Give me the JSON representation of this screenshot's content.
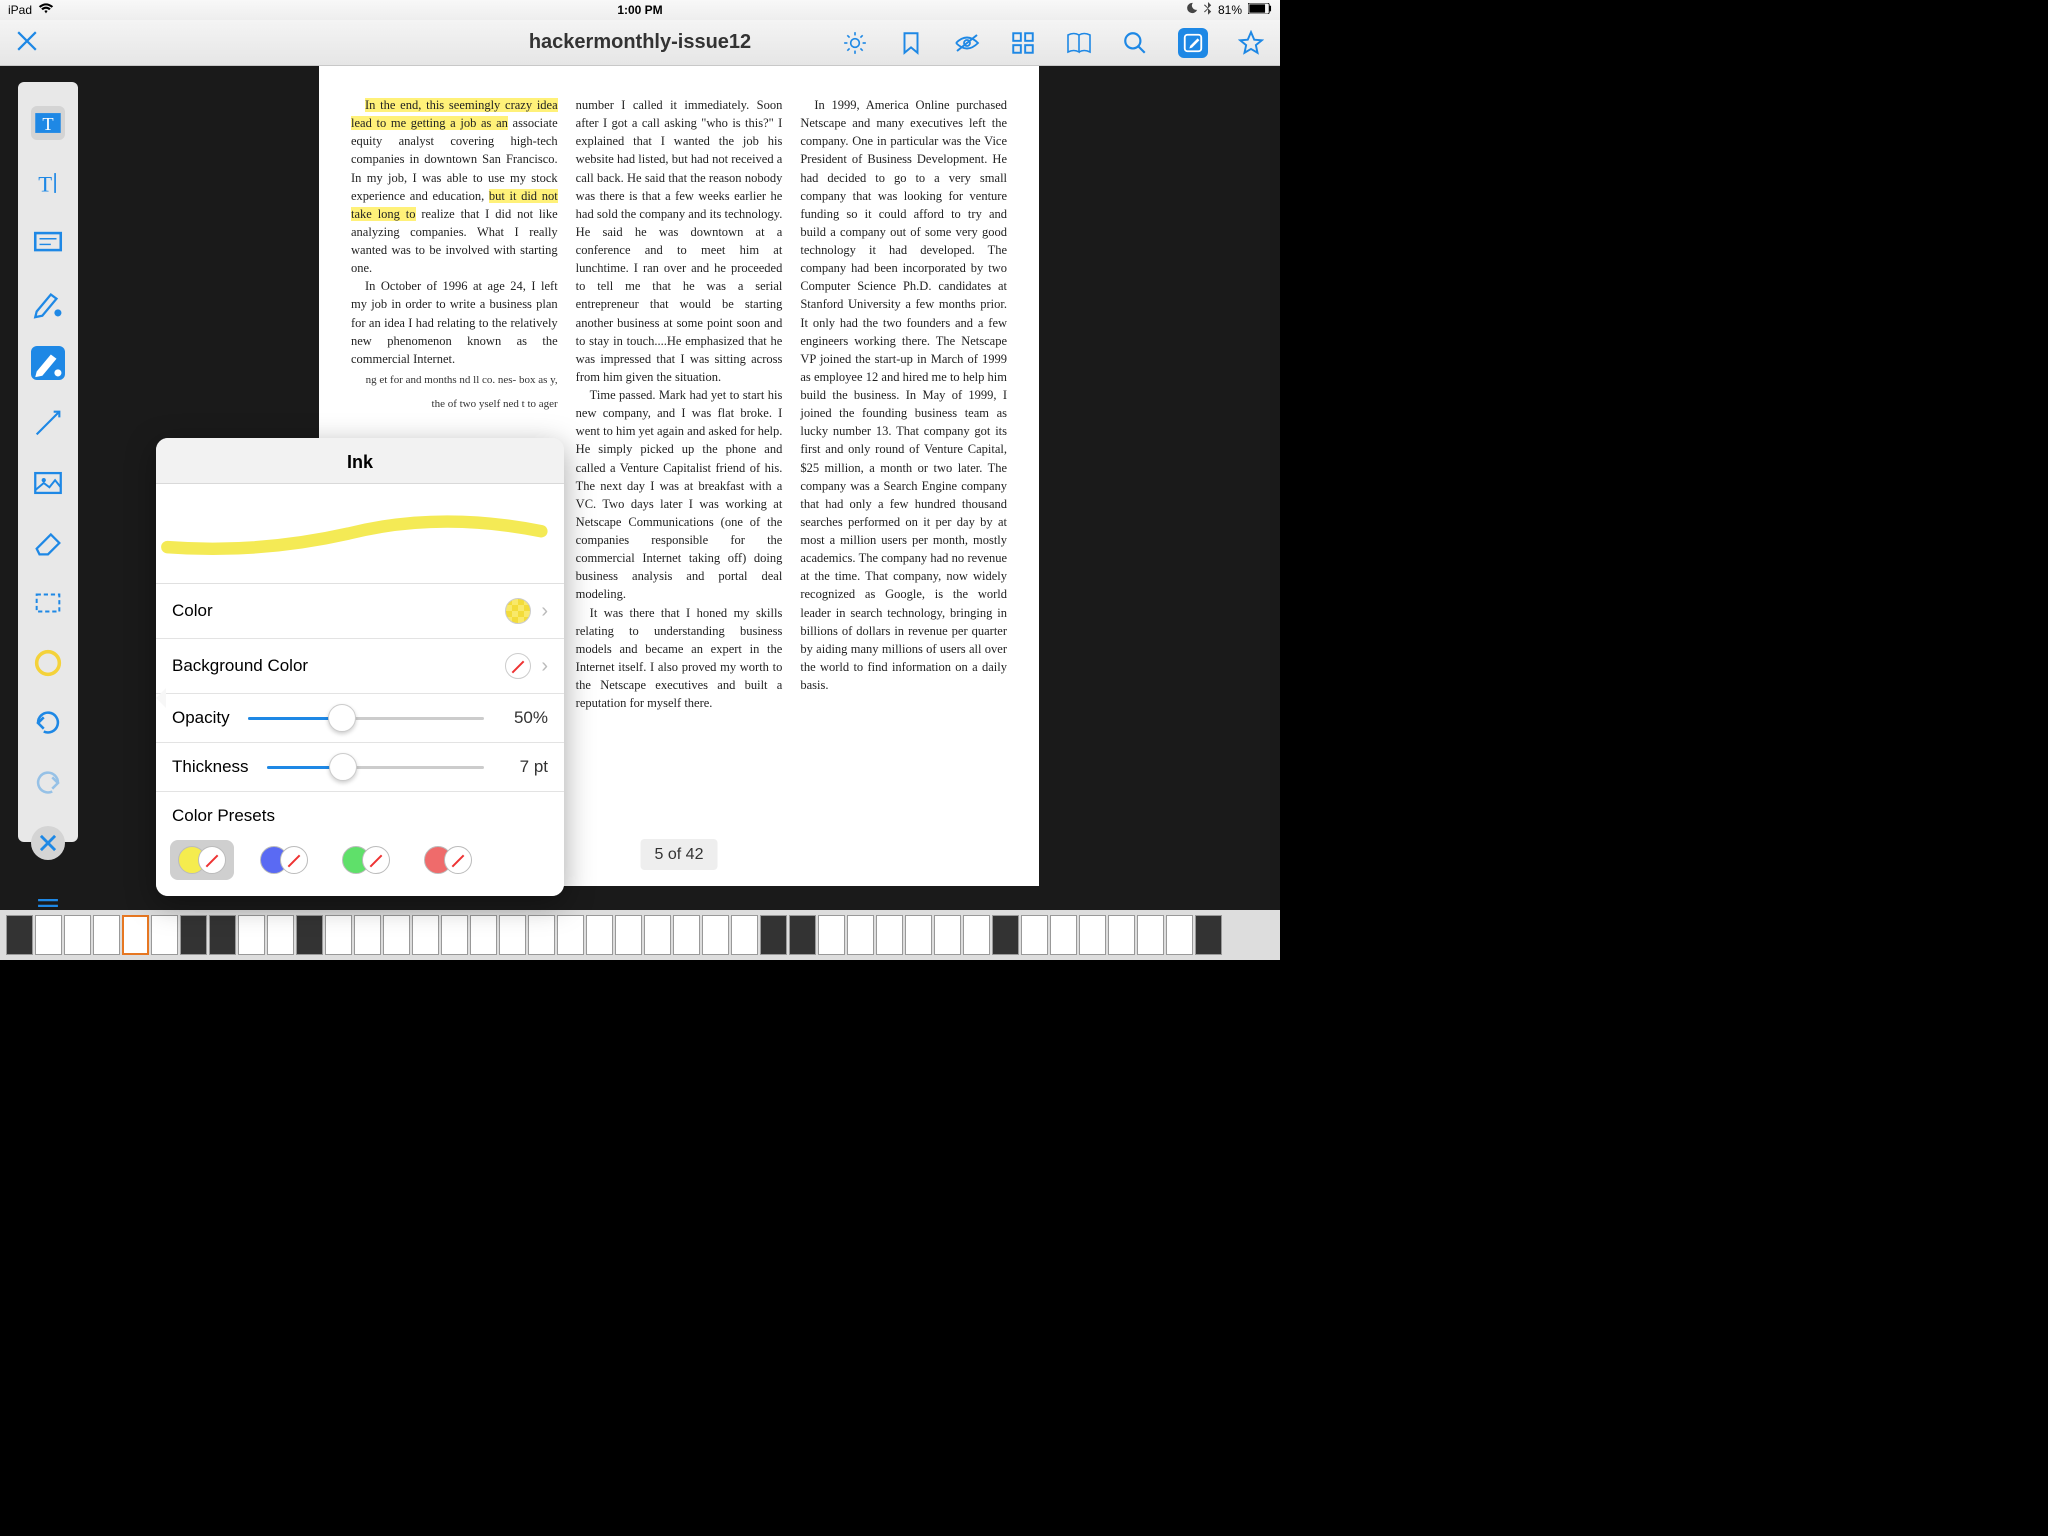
{
  "status": {
    "device": "iPad",
    "time": "1:00 PM",
    "battery": "81%"
  },
  "document": {
    "title": "hackermonthly-issue12",
    "page_indicator": "5 of 42"
  },
  "ink_panel": {
    "title": "Ink",
    "color_label": "Color",
    "bgcolor_label": "Background Color",
    "opacity_label": "Opacity",
    "opacity_value": "50%",
    "thickness_label": "Thickness",
    "thickness_value": "7 pt",
    "presets_label": "Color Presets",
    "preset_colors": [
      "#f5ec4e",
      "#5a6af3",
      "#5fe06a",
      "#ef6b6b"
    ]
  },
  "body": {
    "col1": {
      "p1a": "In the end, this seemingly crazy idea lead to me getting a job as an",
      "p1b": " associate equity analyst covering high-tech companies in downtown San Francisco. In my job, I was able to use my stock experience and education, ",
      "p1c": "but it did not take long to",
      "p1d": " realize that I did not like analyzing companies. What I really wanted was to be involved with starting one.",
      "p2": "In October of 1996 at age 24, I left my job in order to write a business plan for an idea I had relating to the relatively new phenomenon known as the commercial Internet."
    },
    "col1_frag": "ng et for and months nd ll co. nes- box as y, the of two yself ned t to ager",
    "col2": {
      "p1": "number I called it immediately. Soon after I got a call asking \"who is this?\" I explained that I wanted the job his website had listed, but had not received a call back. He said that the reason nobody was there is that a few weeks earlier he had sold the company and its technology. He said he was downtown at a conference and to meet him at lunchtime. I ran over and he proceeded to tell me that he was a serial entrepreneur that would be starting another business at some point soon and to stay in touch....He emphasized that he was impressed that I was sitting across from him given the situation.",
      "p2": "Time passed. Mark had yet to start his new company, and I was flat broke. I went to him yet again and asked for help. He simply picked up the phone and called a Venture Capitalist friend of his. The next day I was at breakfast with a VC. Two days later I was working at Netscape Communications (one of the companies responsible for the commercial Internet taking off) doing business analysis and portal deal modeling.",
      "p3": "It was there that I honed my skills relating to understanding business models and became an expert in the Internet itself. I also proved my worth to the Netscape executives and built a reputation for myself there."
    },
    "col3": {
      "p1": "In 1999, America Online purchased Netscape and many executives left the company. One in particular was the Vice President of Business Development. He had decided to go to a very small company that was looking for venture funding so it could afford to try and build a company out of some very good technology it had developed. The company had been incorporated by two Computer Science Ph.D. candidates at Stanford University a few months prior. It only had the two founders and a few engineers working there. The Netscape VP joined the start-up in March of 1999 as employee 12 and hired me to help him build the business. In May of 1999, I joined the founding business team as lucky number 13. That company got its first and only round of Venture Capital, $25 million, a month or two later. The company was a Search Engine company that had only a few hundred thousand searches performed on it per day by at most a million users per month, mostly academics. The company had no revenue at the time. That company, now widely recognized as Google, is the world leader in search technology, bringing in billions of dollars in revenue per quarter by aiding many millions of users all over the world to find information on a daily basis."
    }
  }
}
